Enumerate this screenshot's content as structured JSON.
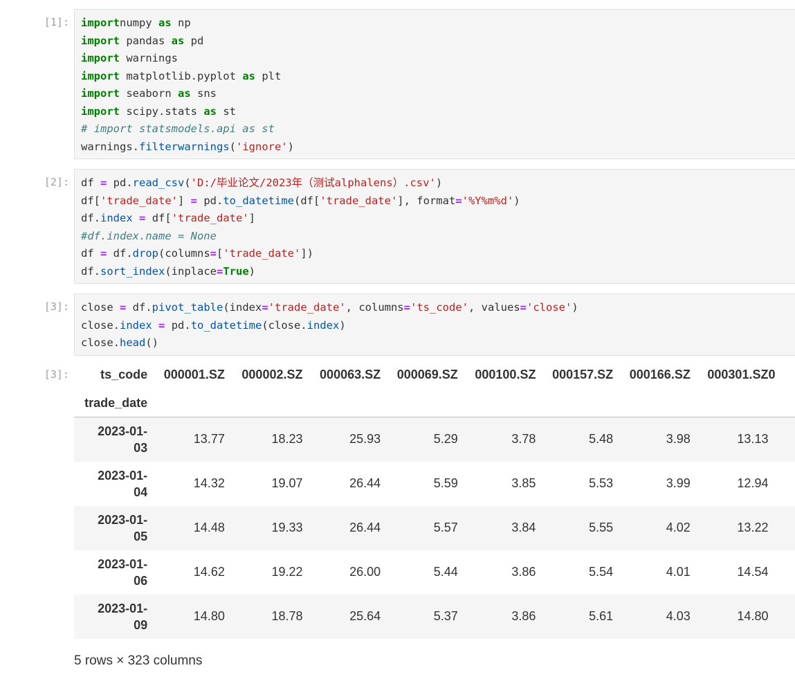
{
  "cells": [
    {
      "prompt": "[1]:",
      "lines": [
        [
          [
            "kw",
            "import"
          ],
          [
            "",
            "numpy "
          ],
          [
            "kw",
            "as"
          ],
          [
            "",
            " np"
          ]
        ],
        [
          [
            "kw",
            "import"
          ],
          [
            "",
            " pandas "
          ],
          [
            "kw",
            "as"
          ],
          [
            "",
            " pd"
          ]
        ],
        [
          [
            "kw",
            "import"
          ],
          [
            "",
            " warnings"
          ]
        ],
        [
          [
            "kw",
            "import"
          ],
          [
            "",
            " matplotlib.pyplot "
          ],
          [
            "kw",
            "as"
          ],
          [
            "",
            " plt"
          ]
        ],
        [
          [
            "kw",
            "import"
          ],
          [
            "",
            " seaborn "
          ],
          [
            "kw",
            "as"
          ],
          [
            "",
            " sns"
          ]
        ],
        [
          [
            "kw",
            "import"
          ],
          [
            "",
            " scipy.stats "
          ],
          [
            "kw",
            "as"
          ],
          [
            "",
            " st"
          ]
        ],
        [
          [
            "cm",
            "# import statsmodels.api as st"
          ]
        ],
        [
          [
            "",
            "warnings."
          ],
          [
            "fn",
            "filterwarnings"
          ],
          [
            "",
            "("
          ],
          [
            "str",
            "'ignore'"
          ],
          [
            "",
            ")"
          ]
        ]
      ]
    },
    {
      "prompt": "[2]:",
      "lines": [
        [
          [
            "",
            "df "
          ],
          [
            "op",
            "="
          ],
          [
            "",
            " pd."
          ],
          [
            "fn",
            "read_csv"
          ],
          [
            "",
            "("
          ],
          [
            "str",
            "'D:/毕业论文/2023年（测试alphalens）.csv'"
          ],
          [
            "",
            ")"
          ]
        ],
        [
          [
            "",
            "df["
          ],
          [
            "str",
            "'trade_date'"
          ],
          [
            "",
            "] "
          ],
          [
            "op",
            "="
          ],
          [
            "",
            " pd."
          ],
          [
            "fn",
            "to_datetime"
          ],
          [
            "",
            "(df["
          ],
          [
            "str",
            "'trade_date'"
          ],
          [
            "",
            "], format"
          ],
          [
            "op",
            "="
          ],
          [
            "str",
            "'%Y%m%d'"
          ],
          [
            "",
            ")"
          ]
        ],
        [
          [
            "",
            "df."
          ],
          [
            "fn",
            "index"
          ],
          [
            "",
            " "
          ],
          [
            "op",
            "="
          ],
          [
            "",
            " df["
          ],
          [
            "str",
            "'trade_date'"
          ],
          [
            "",
            "]"
          ]
        ],
        [
          [
            "cm",
            "#df.index.name = None"
          ]
        ],
        [
          [
            "",
            "df "
          ],
          [
            "op",
            "="
          ],
          [
            "",
            " df."
          ],
          [
            "fn",
            "drop"
          ],
          [
            "",
            "(columns"
          ],
          [
            "op",
            "="
          ],
          [
            "",
            "["
          ],
          [
            "str",
            "'trade_date'"
          ],
          [
            "",
            "])"
          ]
        ],
        [
          [
            "",
            "df."
          ],
          [
            "fn",
            "sort_index"
          ],
          [
            "",
            "(inplace"
          ],
          [
            "op",
            "="
          ],
          [
            "kc",
            "True"
          ],
          [
            "",
            ")"
          ]
        ]
      ]
    },
    {
      "prompt": "[3]:",
      "lines": [
        [
          [
            "",
            "close "
          ],
          [
            "op",
            "="
          ],
          [
            "",
            " df."
          ],
          [
            "fn",
            "pivot_table"
          ],
          [
            "",
            "(index"
          ],
          [
            "op",
            "="
          ],
          [
            "str",
            "'trade_date'"
          ],
          [
            "",
            ", columns"
          ],
          [
            "op",
            "="
          ],
          [
            "str",
            "'ts_code'"
          ],
          [
            "",
            ", values"
          ],
          [
            "op",
            "="
          ],
          [
            "str",
            "'close'"
          ],
          [
            "",
            ")"
          ]
        ],
        [
          [
            "",
            "close."
          ],
          [
            "fn",
            "index"
          ],
          [
            "",
            " "
          ],
          [
            "op",
            "="
          ],
          [
            "",
            " pd."
          ],
          [
            "fn",
            "to_datetime"
          ],
          [
            "",
            "(close."
          ],
          [
            "fn",
            "index"
          ],
          [
            "",
            ")"
          ]
        ],
        [
          [
            "",
            "close."
          ],
          [
            "fn",
            "head"
          ],
          [
            "",
            "()"
          ]
        ]
      ]
    }
  ],
  "output": {
    "prompt": "[3]:",
    "columns_name": "ts_code",
    "index_name": "trade_date",
    "columns": [
      "000001.SZ",
      "000002.SZ",
      "000063.SZ",
      "000069.SZ",
      "000100.SZ",
      "000157.SZ",
      "000166.SZ",
      "000301.SZ",
      "0"
    ],
    "rows": [
      {
        "index": [
          "2023-01-",
          "03"
        ],
        "values": [
          "13.77",
          "18.23",
          "25.93",
          "5.29",
          "3.78",
          "5.48",
          "3.98",
          "13.13"
        ]
      },
      {
        "index": [
          "2023-01-",
          "04"
        ],
        "values": [
          "14.32",
          "19.07",
          "26.44",
          "5.59",
          "3.85",
          "5.53",
          "3.99",
          "12.94"
        ]
      },
      {
        "index": [
          "2023-01-",
          "05"
        ],
        "values": [
          "14.48",
          "19.33",
          "26.44",
          "5.57",
          "3.84",
          "5.55",
          "4.02",
          "13.22"
        ]
      },
      {
        "index": [
          "2023-01-",
          "06"
        ],
        "values": [
          "14.62",
          "19.22",
          "26.00",
          "5.44",
          "3.86",
          "5.54",
          "4.01",
          "14.54"
        ]
      },
      {
        "index": [
          "2023-01-",
          "09"
        ],
        "values": [
          "14.80",
          "18.78",
          "25.64",
          "5.37",
          "3.86",
          "5.61",
          "4.03",
          "14.80"
        ]
      }
    ],
    "footer": "5 rows × 323 columns"
  }
}
